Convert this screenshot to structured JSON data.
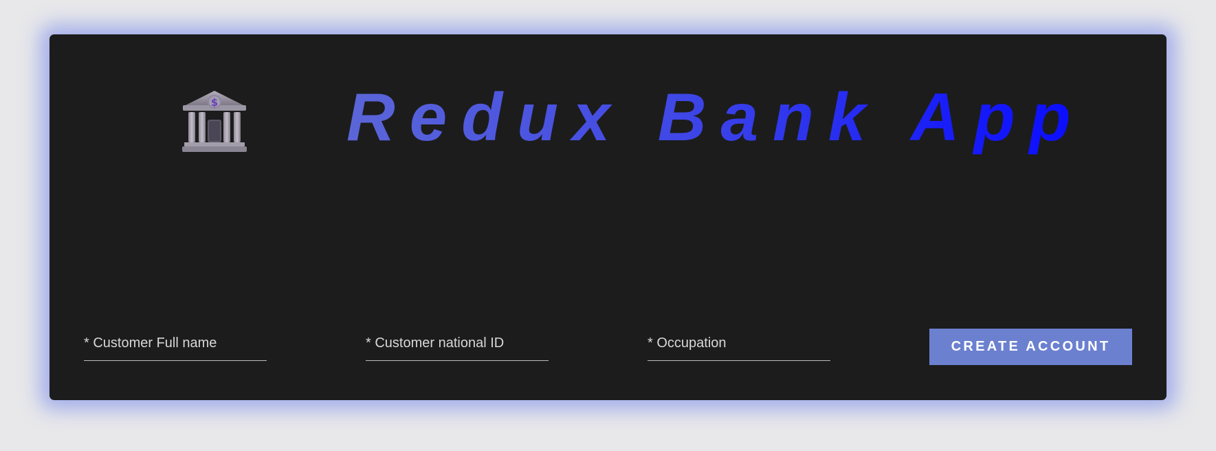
{
  "app": {
    "title": "Redux Bank App",
    "logo_icon": "bank-icon"
  },
  "form": {
    "full_name": {
      "placeholder": "* Customer Full name",
      "value": ""
    },
    "national_id": {
      "placeholder": "* Customer national ID",
      "value": ""
    },
    "occupation": {
      "placeholder": "* Occupation",
      "value": ""
    },
    "create_button_label": "CREATE ACCOUNT"
  },
  "colors": {
    "page_background": "#e8e8ea",
    "card_background": "#1c1c1c",
    "card_glow": "#6e82eb",
    "title_gradient_start": "#5b66d8",
    "title_gradient_end": "#0a0cff",
    "button_background": "#6b80cf",
    "button_text": "#ffffff",
    "input_underline": "#bdbdbd"
  }
}
